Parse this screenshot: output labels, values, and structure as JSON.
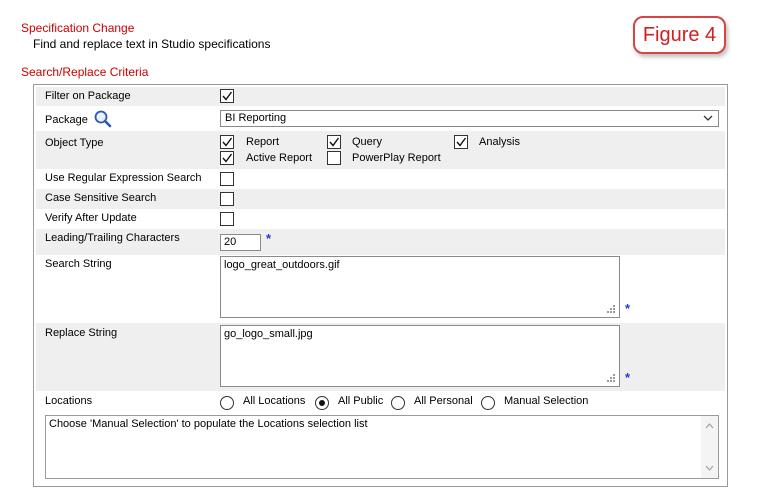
{
  "header": {
    "title": "Specification Change",
    "subtitle": "Find and replace text in Studio specifications",
    "section_title": "Search/Replace Criteria",
    "figure_label": "Figure 4"
  },
  "form": {
    "filter_on_package": {
      "label": "Filter on Package",
      "checked": true
    },
    "package": {
      "label": "Package",
      "value": "BI Reporting",
      "icon": "magnifier-icon"
    },
    "object_type": {
      "label": "Object Type",
      "options": [
        {
          "label": "Report",
          "checked": true
        },
        {
          "label": "Query",
          "checked": true
        },
        {
          "label": "Analysis",
          "checked": true
        },
        {
          "label": "Active Report",
          "checked": true
        },
        {
          "label": "PowerPlay Report",
          "checked": false
        }
      ]
    },
    "use_regex": {
      "label": "Use Regular Expression Search",
      "checked": false
    },
    "case_sensitive": {
      "label": "Case Sensitive Search",
      "checked": false
    },
    "verify_after_update": {
      "label": "Verify After Update",
      "checked": false
    },
    "leading_trailing": {
      "label": "Leading/Trailing Characters",
      "value": "20"
    },
    "search_string": {
      "label": "Search String",
      "value": "logo_great_outdoors.gif"
    },
    "replace_string": {
      "label": "Replace String",
      "value": "go_logo_small.jpg"
    },
    "required_marker": "*",
    "locations": {
      "label": "Locations",
      "options": [
        {
          "label": "All Locations",
          "selected": false
        },
        {
          "label": "All Public",
          "selected": true
        },
        {
          "label": "All Personal",
          "selected": false
        },
        {
          "label": "Manual Selection",
          "selected": false
        }
      ],
      "hint": "Choose 'Manual Selection' to populate the Locations selection list"
    }
  },
  "colors": {
    "header_red": "#cc0000",
    "required_blue": "#1a3fd6",
    "row_alt": "#efefef"
  }
}
